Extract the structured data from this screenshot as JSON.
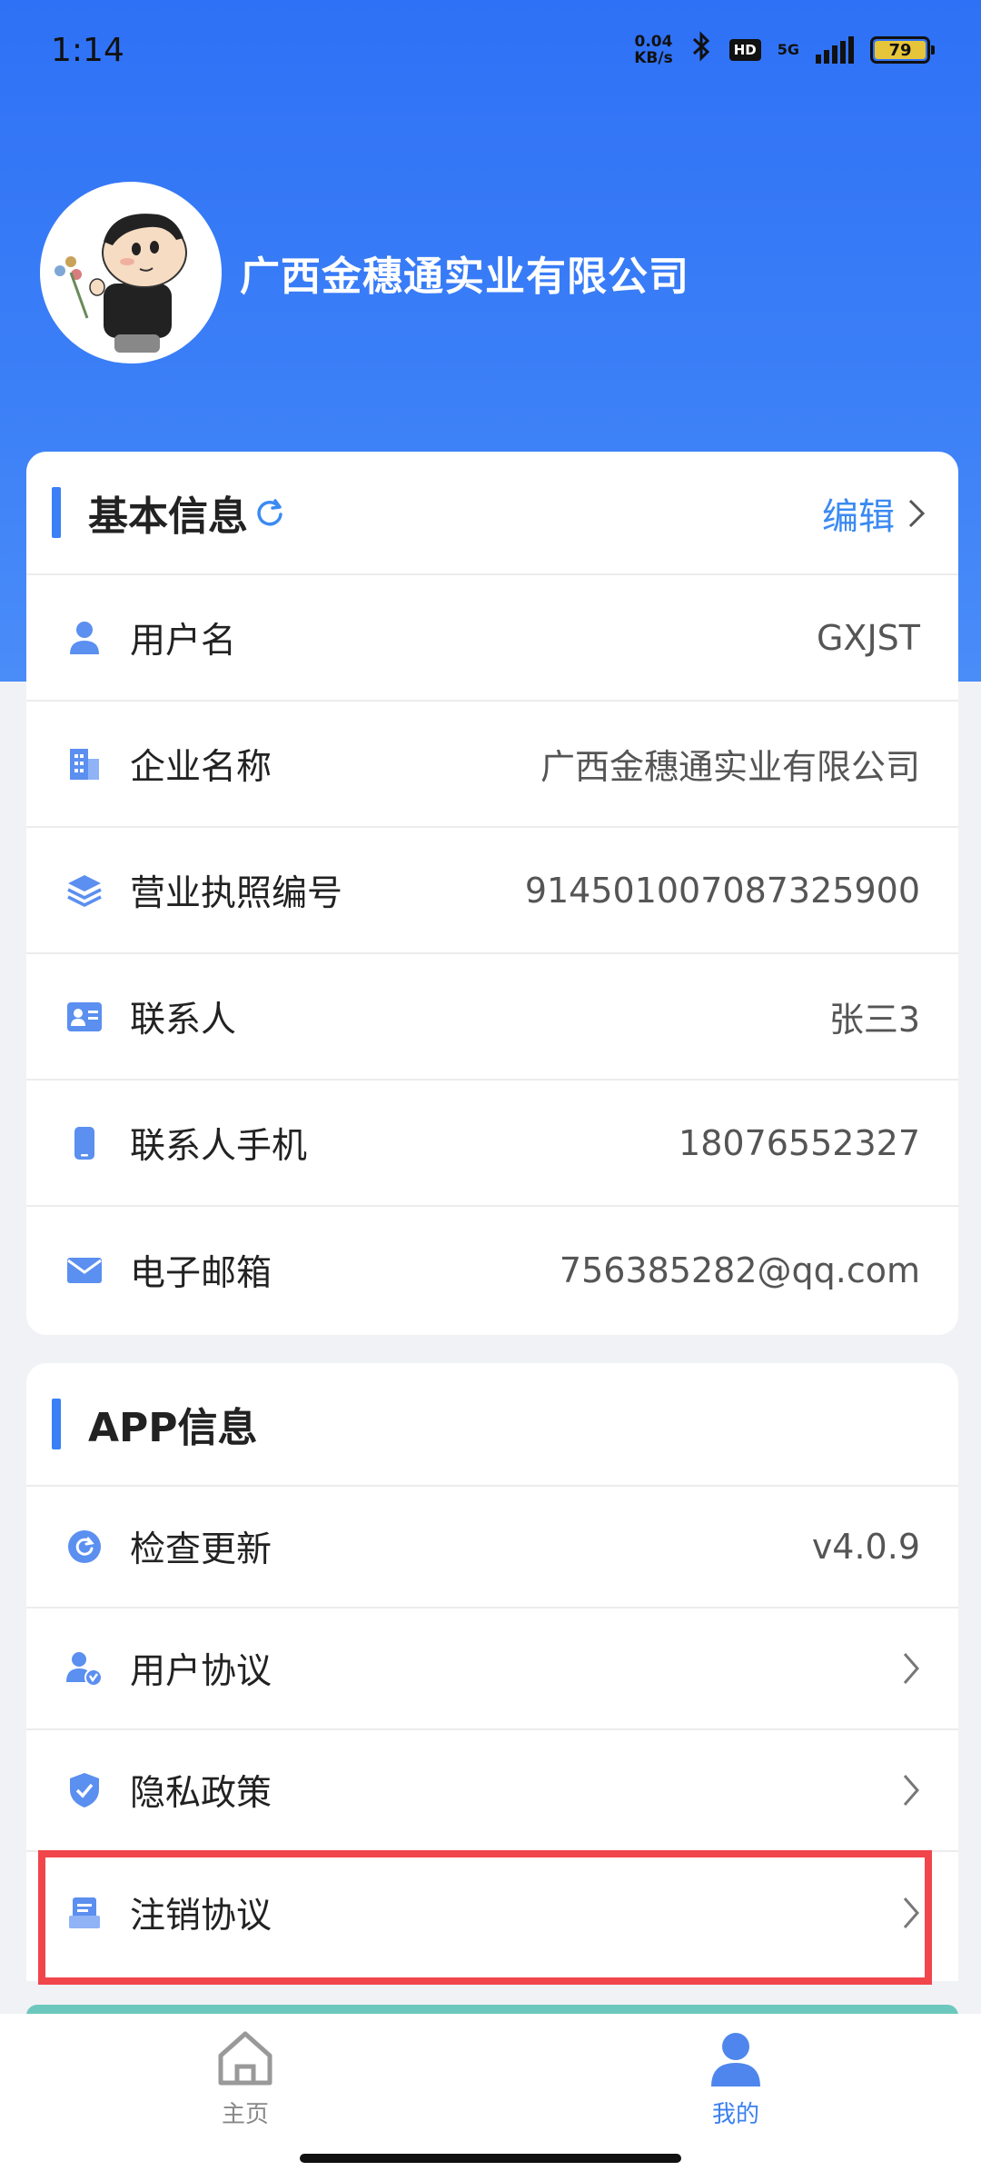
{
  "status_bar": {
    "time": "1:14",
    "net_speed_value": "0.04",
    "net_speed_unit": "KB/s",
    "hd": "HD",
    "network": "5G",
    "battery": "79"
  },
  "profile": {
    "company_name": "广西金穗通实业有限公司"
  },
  "basic_info": {
    "title": "基本信息",
    "edit_label": "编辑",
    "rows": [
      {
        "label": "用户名",
        "value": "GXJST",
        "icon": "user-icon"
      },
      {
        "label": "企业名称",
        "value": "广西金穗通实业有限公司",
        "icon": "building-icon"
      },
      {
        "label": "营业执照编号",
        "value": "914501007087325900",
        "icon": "layers-icon"
      },
      {
        "label": "联系人",
        "value": "张三3",
        "icon": "contact-card-icon"
      },
      {
        "label": "联系人手机",
        "value": "18076552327",
        "icon": "phone-icon"
      },
      {
        "label": "电子邮箱",
        "value": "756385282@qq.com",
        "icon": "mail-icon"
      }
    ]
  },
  "app_info": {
    "title": "APP信息",
    "rows": [
      {
        "label": "检查更新",
        "value": "v4.0.9",
        "icon": "refresh-circle-icon"
      },
      {
        "label": "用户协议",
        "icon": "user-verified-icon"
      },
      {
        "label": "隐私政策",
        "icon": "shield-check-icon"
      },
      {
        "label": "注销协议",
        "icon": "document-icon"
      }
    ]
  },
  "bottom_nav": {
    "items": [
      {
        "label": "主页",
        "icon": "home-icon",
        "active": false
      },
      {
        "label": "我的",
        "icon": "person-icon",
        "active": true
      }
    ]
  },
  "colors": {
    "primary": "#3b7ff7",
    "highlight": "#f1454c",
    "link": "#3b8af2"
  }
}
